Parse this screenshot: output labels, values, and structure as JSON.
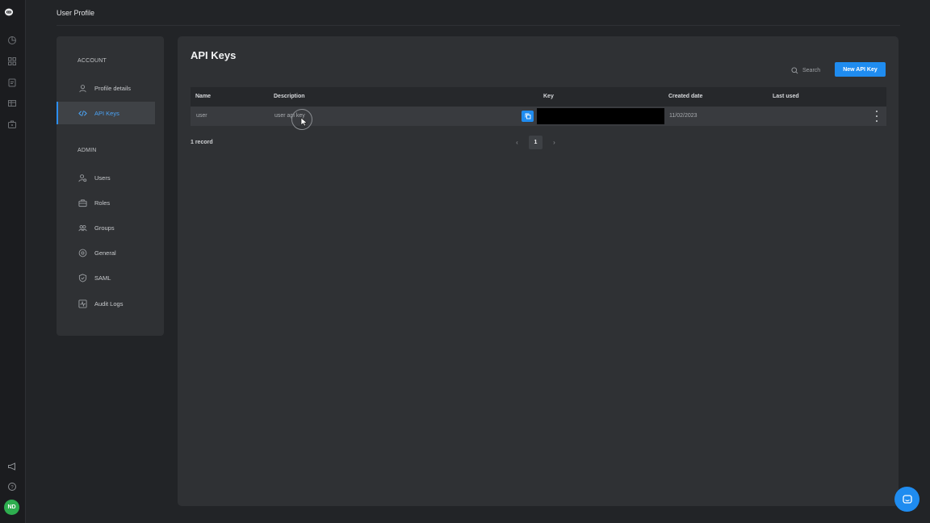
{
  "header": {
    "title": "User Profile"
  },
  "rail": {
    "avatar_initials": "ND",
    "icons": [
      "dashboard-icon",
      "grid-icon",
      "clipboard-icon",
      "table-icon",
      "briefcase-icon",
      "megaphone-icon",
      "help-icon"
    ]
  },
  "settings_nav": {
    "account_heading": "ACCOUNT",
    "admin_heading": "ADMIN",
    "items": [
      {
        "label": "Profile details",
        "icon": "user-icon"
      },
      {
        "label": "API Keys",
        "icon": "code-icon",
        "active": true
      },
      {
        "label": "Users",
        "icon": "users-settings-icon"
      },
      {
        "label": "Roles",
        "icon": "briefcase-icon"
      },
      {
        "label": "Groups",
        "icon": "groups-icon"
      },
      {
        "label": "General",
        "icon": "settings-icon"
      },
      {
        "label": "SAML",
        "icon": "shield-icon"
      },
      {
        "label": "Audit Logs",
        "icon": "activity-icon"
      }
    ]
  },
  "main": {
    "title": "API Keys",
    "search_label": "Search",
    "new_button": "New API Key",
    "table": {
      "columns": [
        "Name",
        "Description",
        "Key",
        "Created date",
        "Last used"
      ],
      "rows": [
        {
          "name": "user",
          "description": "user api key",
          "key": "",
          "created": "11/02/2023",
          "last_used": ""
        }
      ]
    },
    "record_count": "1 record",
    "pagination": {
      "prev": "‹",
      "page": "1",
      "next": "›"
    }
  },
  "colors": {
    "accent": "#1f8cf0",
    "active_text": "#4ba3f5",
    "avatar": "#2eae4f"
  }
}
